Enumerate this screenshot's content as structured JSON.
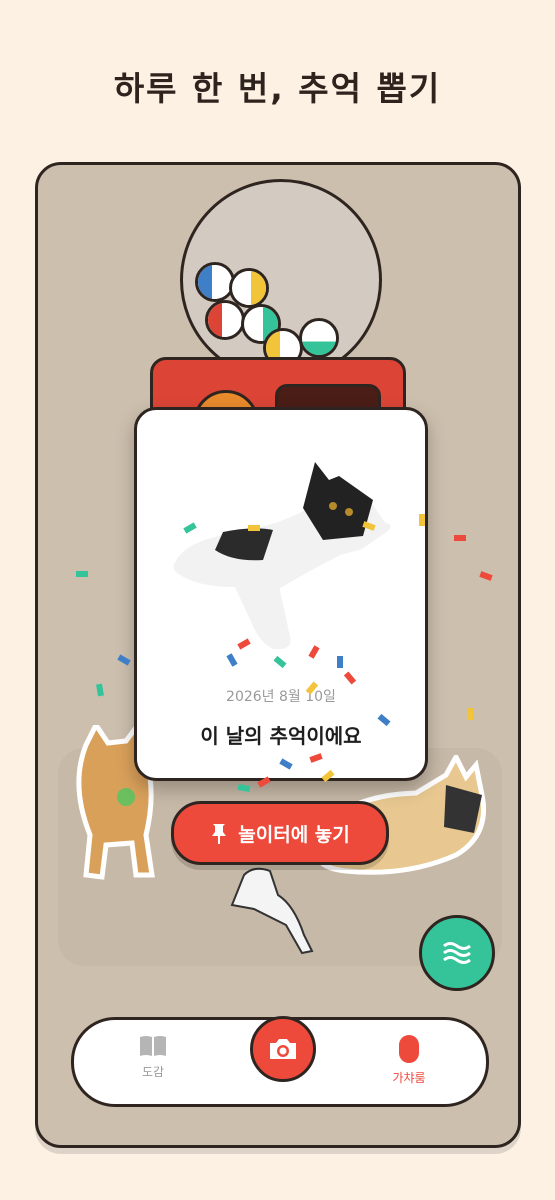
{
  "headline": "하루 한 번, 추억 뽑기",
  "card": {
    "date": "2026년 8월 10일",
    "title": "이 날의 추억이에요"
  },
  "place_button": {
    "label": "놀이터에 놓기"
  },
  "nav": {
    "collection_label": "도감",
    "gacha_label": "가챠룸",
    "active": "가챠룸"
  },
  "icons": [
    "pin-icon",
    "wave-icon",
    "book-icon",
    "camera-icon",
    "capsule-icon"
  ],
  "colors": {
    "accent_red": "#ee4a3c",
    "mint": "#35c49a",
    "frame": "#cdbfae",
    "background": "#fdf1e4"
  }
}
